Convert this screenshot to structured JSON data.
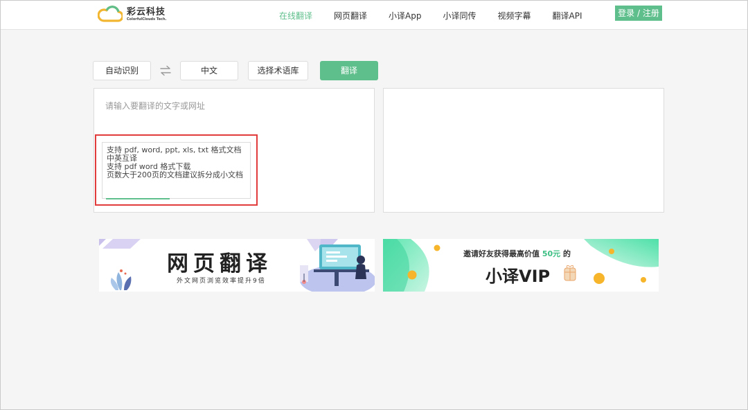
{
  "brand": {
    "name_cn": "彩云科技",
    "name_en": "ColorfulClouds Tech."
  },
  "nav": {
    "items": [
      {
        "label": "在线翻译",
        "active": true
      },
      {
        "label": "网页翻译",
        "active": false
      },
      {
        "label": "小译App",
        "active": false
      },
      {
        "label": "小译同传",
        "active": false
      },
      {
        "label": "视频字幕",
        "active": false
      },
      {
        "label": "翻译API",
        "active": false
      }
    ],
    "login_label": "登录 / 注册"
  },
  "toolbar": {
    "source_language": "自动识别",
    "target_language": "中文",
    "glossary_label": "选择术语库",
    "translate_label": "翻译",
    "swap_icon": "swap-arrows-icon"
  },
  "input_panel": {
    "placeholder": "请输入要翻译的文字或网址",
    "upload_tip": {
      "lines": [
        "支持 pdf, word, ppt, xls, txt 格式文档中英互译",
        "支持 pdf word 格式下载",
        "页数大于200页的文档建议拆分成小文档"
      ]
    }
  },
  "banners": {
    "web": {
      "title": "网页翻译",
      "subtitle": "外文网页浏览效率提升9倍"
    },
    "vip": {
      "line_prefix": "邀请好友获得最高价值 ",
      "line_amount": "50元",
      "line_suffix": " 的",
      "title": "小译VIP"
    }
  },
  "colors": {
    "accent": "#5fbf8c",
    "highlight": "#e23b3b",
    "vip_green": "#3dbf84"
  }
}
